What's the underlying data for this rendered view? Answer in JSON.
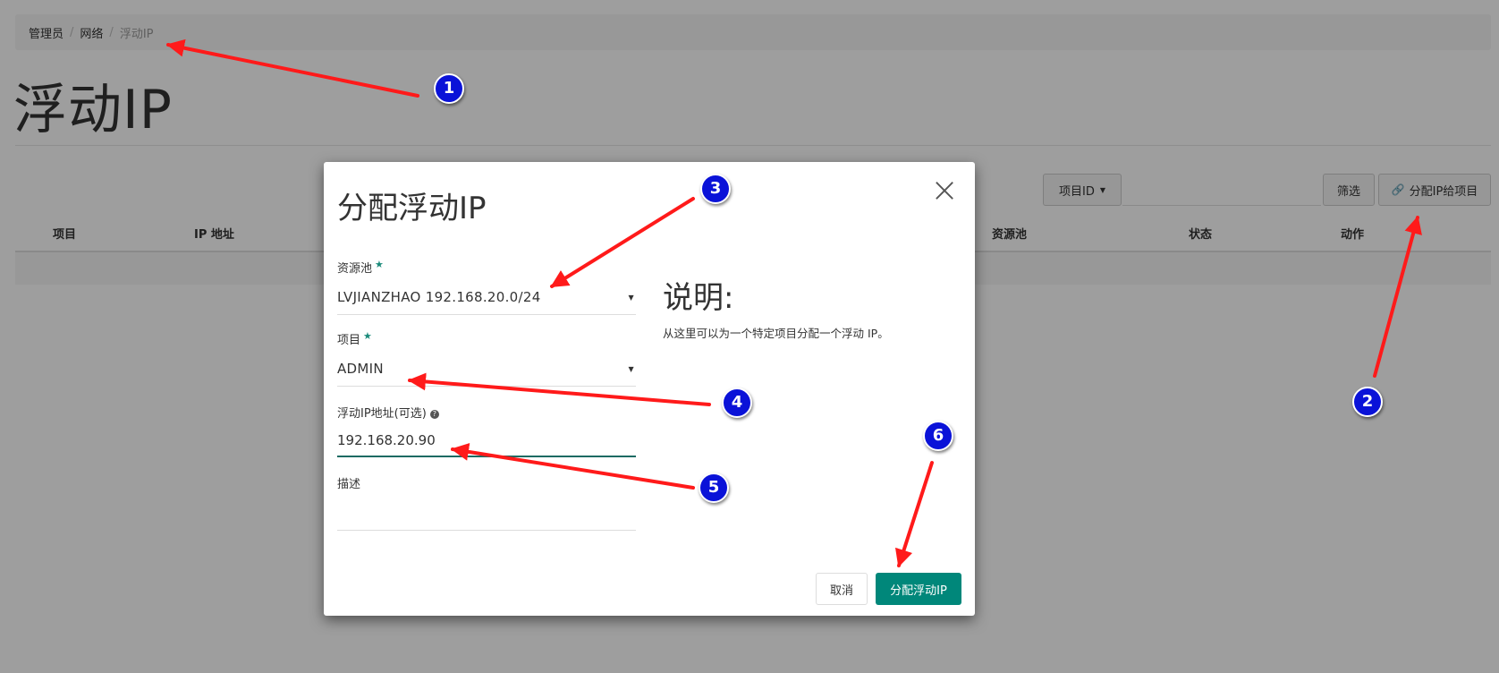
{
  "breadcrumb": {
    "item1": "管理员",
    "item2": "网络",
    "active": "浮动IP",
    "separator": "/"
  },
  "page": {
    "title": "浮动IP"
  },
  "table_controls": {
    "project_filter_label": "项目ID",
    "filter_button": "筛选",
    "allocate_button": "分配IP给项目",
    "link_icon": "link-icon"
  },
  "table": {
    "columns": [
      "项目",
      "IP 地址",
      "资源池",
      "状态",
      "动作"
    ]
  },
  "modal": {
    "title": "分配浮动IP",
    "close_icon": "×",
    "pool_label": "资源池",
    "pool_value": "LVJIANZHAO 192.168.20.0/24",
    "project_label": "项目",
    "project_value": "ADMIN",
    "ip_label": "浮动IP地址(可选)",
    "ip_value": "192.168.20.90",
    "desc_label": "描述",
    "help_title": "说明:",
    "help_text": "从这里可以为一个特定项目分配一个浮动 IP。",
    "cancel_button": "取消",
    "submit_button": "分配浮动IP",
    "required_star": "★"
  },
  "annotations": {
    "labels": [
      "1",
      "2",
      "3",
      "4",
      "5",
      "6"
    ],
    "arrow_color": "#ff1a1a",
    "badge_color": "#0a12d8"
  },
  "colors": {
    "primary": "#00877a",
    "overlay": "rgba(0,0,0,0.38)"
  }
}
